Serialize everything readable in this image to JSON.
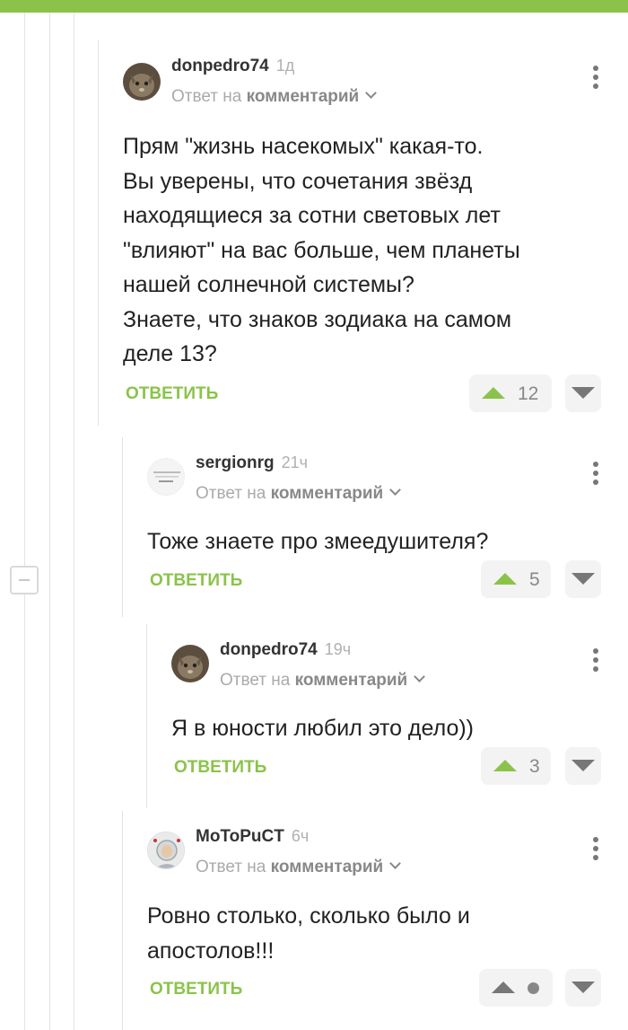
{
  "reply_label": "ОТВЕТИТЬ",
  "reply_prefix": "Ответ на",
  "reply_link": "комментарий",
  "comments": [
    {
      "author": "donpedro74",
      "time": "1д",
      "lines": [
        "Прям \"жизнь насекомых\" какая-то.",
        "Вы уверены, что сочетания звёзд",
        "находящиеся за сотни световых лет",
        "\"влияют\" на вас больше, чем планеты",
        "нашей солнечной системы?",
        "Знаете, что знаков зодиака на самом",
        "деле 13?"
      ],
      "rating": "12"
    },
    {
      "author": "sergionrg",
      "time": "21ч",
      "lines": [
        "Тоже знаете про змеедушителя?"
      ],
      "rating": "5"
    },
    {
      "author": "donpedro74",
      "time": "19ч",
      "lines": [
        "Я в юности любил это дело))"
      ],
      "rating": "3"
    },
    {
      "author": "MoToPuCT",
      "time": "6ч",
      "lines": [
        "Ровно столько, сколько было и",
        "апостолов!!!"
      ],
      "rating": ""
    }
  ],
  "colors": {
    "accent": "#8bc34a",
    "topbar": "#8bc34a",
    "muted": "#aaaaaa"
  }
}
